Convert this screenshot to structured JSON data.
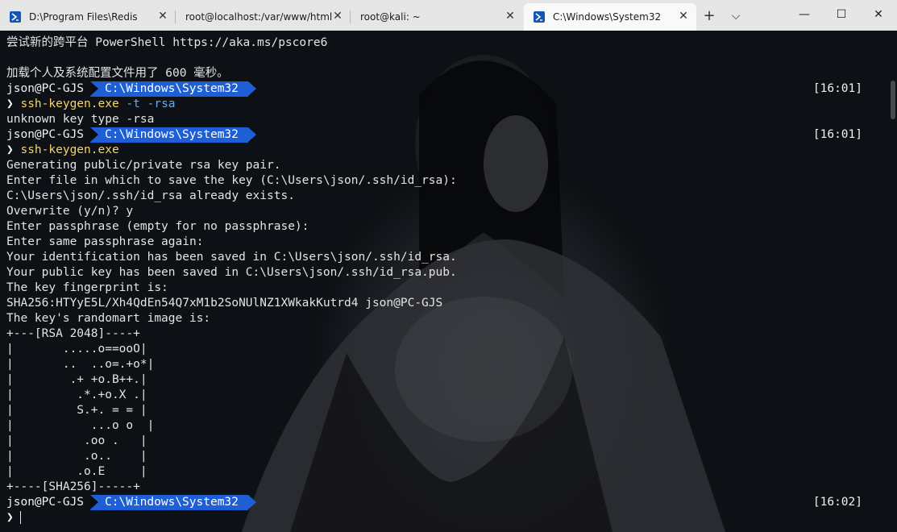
{
  "tabs": [
    {
      "title": "D:\\Program Files\\Redis"
    },
    {
      "title": "root@localhost:/var/www/html"
    },
    {
      "title": "root@kali: ~"
    },
    {
      "title": "C:\\Windows\\System32"
    }
  ],
  "controls": {
    "close": "✕",
    "new_tab": "+",
    "dropdown": "⌵",
    "minimize": "—",
    "maximize": "☐",
    "window_close": "✕"
  },
  "terminal": {
    "banner": "尝试新的跨平台 PowerShell https://aka.ms/pscore6",
    "profile_msg": "加载个人及系统配置文件用了 600 毫秒。",
    "prompt_user": "json@PC-GJS",
    "prompt_path": "C:\\Windows\\System32",
    "chevron": "❯",
    "times": [
      "[16:01]",
      "[16:01]",
      "[16:02]"
    ],
    "cmd1": "ssh-keygen.exe",
    "cmd1_args": "-t -rsa",
    "out1": "unknown key type -rsa",
    "cmd2": "ssh-keygen.exe",
    "output": [
      "Generating public/private rsa key pair.",
      "Enter file in which to save the key (C:\\Users\\json/.ssh/id_rsa):",
      "C:\\Users\\json/.ssh/id_rsa already exists.",
      "Overwrite (y/n)? y",
      "Enter passphrase (empty for no passphrase):",
      "Enter same passphrase again:",
      "Your identification has been saved in C:\\Users\\json/.ssh/id_rsa.",
      "Your public key has been saved in C:\\Users\\json/.ssh/id_rsa.pub.",
      "The key fingerprint is:",
      "SHA256:HTYyE5L/Xh4QdEn54Q7xM1b2SoNUlNZ1XWkakKutrd4 json@PC-GJS",
      "The key's randomart image is:",
      "+---[RSA 2048]----+",
      "|       .....o==ooO|",
      "|       ..  ..o=.+o*|",
      "|        .+ +o.B++.|",
      "|         .*.+o.X .|",
      "|         S.+. = = |",
      "|           ...o o  |",
      "|          .oo .   |",
      "|          .o..    |",
      "|         .o.E     |",
      "+----[SHA256]-----+"
    ]
  }
}
